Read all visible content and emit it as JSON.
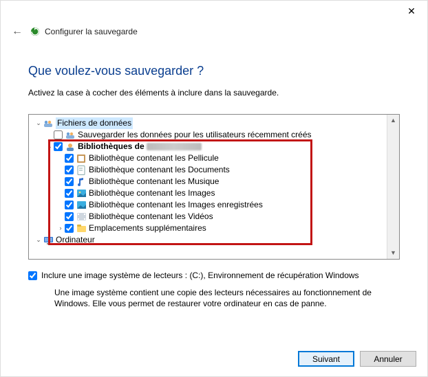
{
  "window_title": "Configurer la sauvegarde",
  "heading": "Que voulez-vous sauvegarder ?",
  "instruction": "Activez la case à cocher des éléments à inclure dans la sauvegarde.",
  "tree": {
    "data_files": "Fichiers de données",
    "save_new_users": "Sauvegarder les données pour les utilisateurs récemment créés",
    "libraries_of": "Bibliothèques de",
    "items": [
      "Bibliothèque contenant les Pellicule",
      "Bibliothèque contenant les Documents",
      "Bibliothèque contenant les Musique",
      "Bibliothèque contenant les Images",
      "Bibliothèque contenant les Images enregistrées",
      "Bibliothèque contenant les Vidéos",
      "Emplacements supplémentaires"
    ],
    "computer": "Ordinateur"
  },
  "system_image_option": "Inclure une image système de lecteurs : (C:), Environnement de récupération Windows",
  "system_image_desc": "Une image système contient une copie des lecteurs nécessaires au fonctionnement de Windows. Elle vous permet de restaurer votre ordinateur en cas de panne.",
  "buttons": {
    "next": "Suivant",
    "cancel": "Annuler"
  },
  "checked": {
    "save_new_users": false,
    "libraries_of": true,
    "lib0": true,
    "lib1": true,
    "lib2": true,
    "lib3": true,
    "lib4": true,
    "lib5": true,
    "lib6": true,
    "system_image": true
  }
}
